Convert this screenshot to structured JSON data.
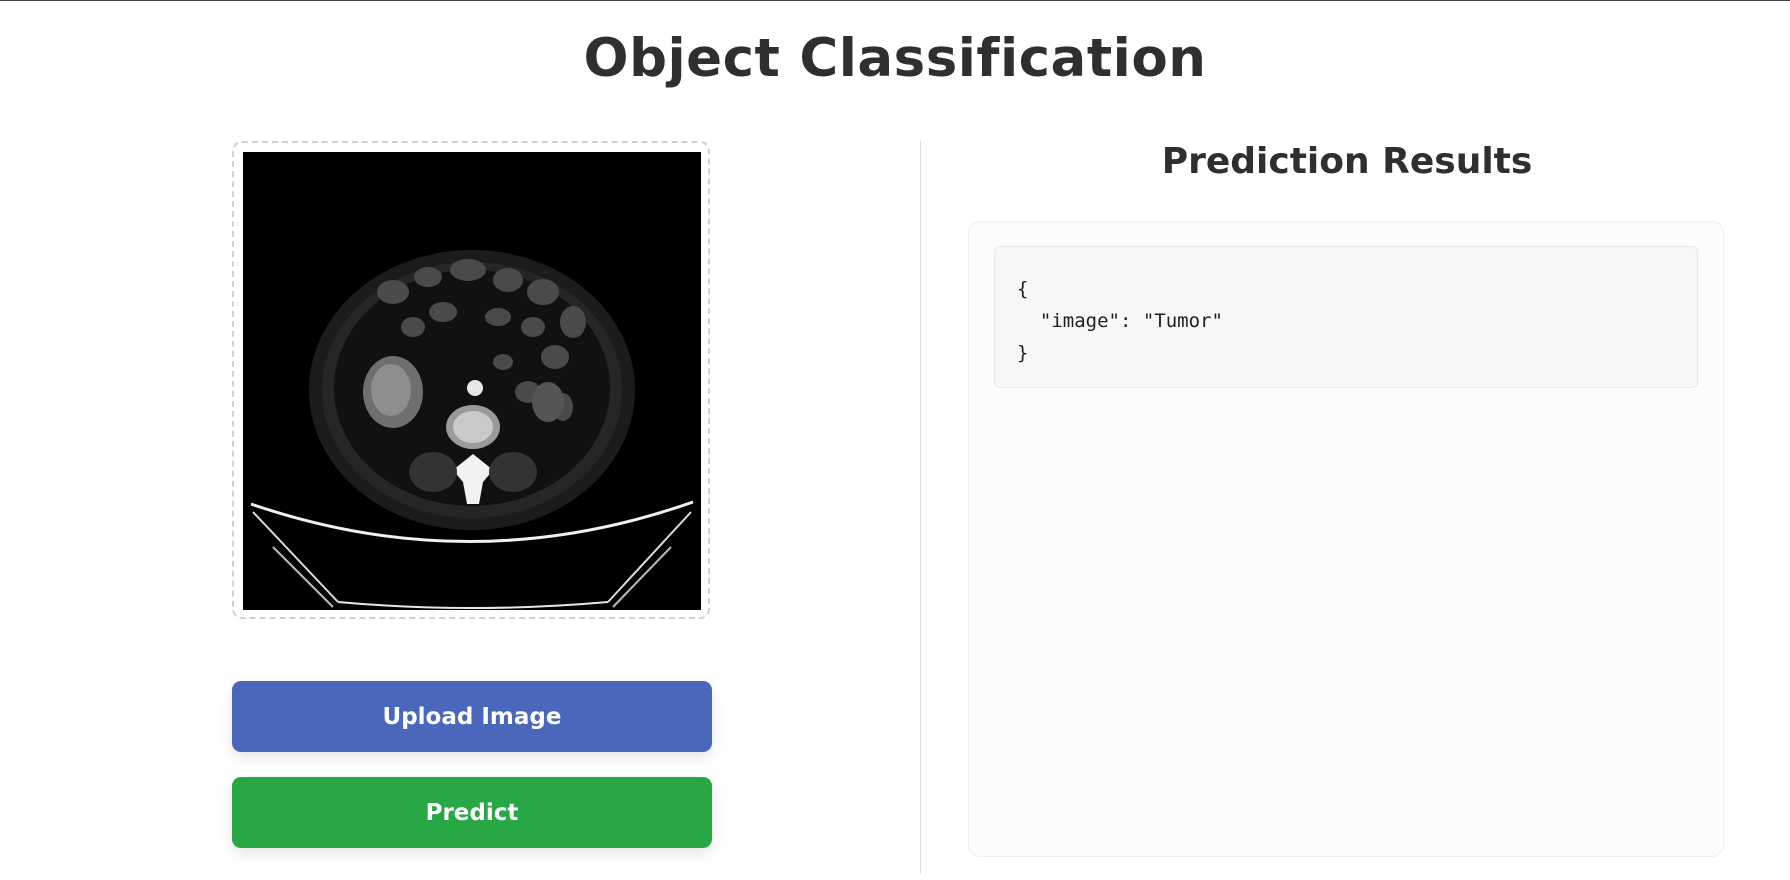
{
  "page": {
    "title": "Object Classification"
  },
  "upload": {
    "image_alt": "CT scan preview",
    "upload_button_label": "Upload Image",
    "predict_button_label": "Predict"
  },
  "results": {
    "heading": "Prediction Results",
    "json_output": "{\n  \"image\": \"Tumor\"\n}"
  },
  "colors": {
    "upload_button": "#4a67bc",
    "predict_button": "#28a745",
    "title_text": "#2f2f2f"
  }
}
